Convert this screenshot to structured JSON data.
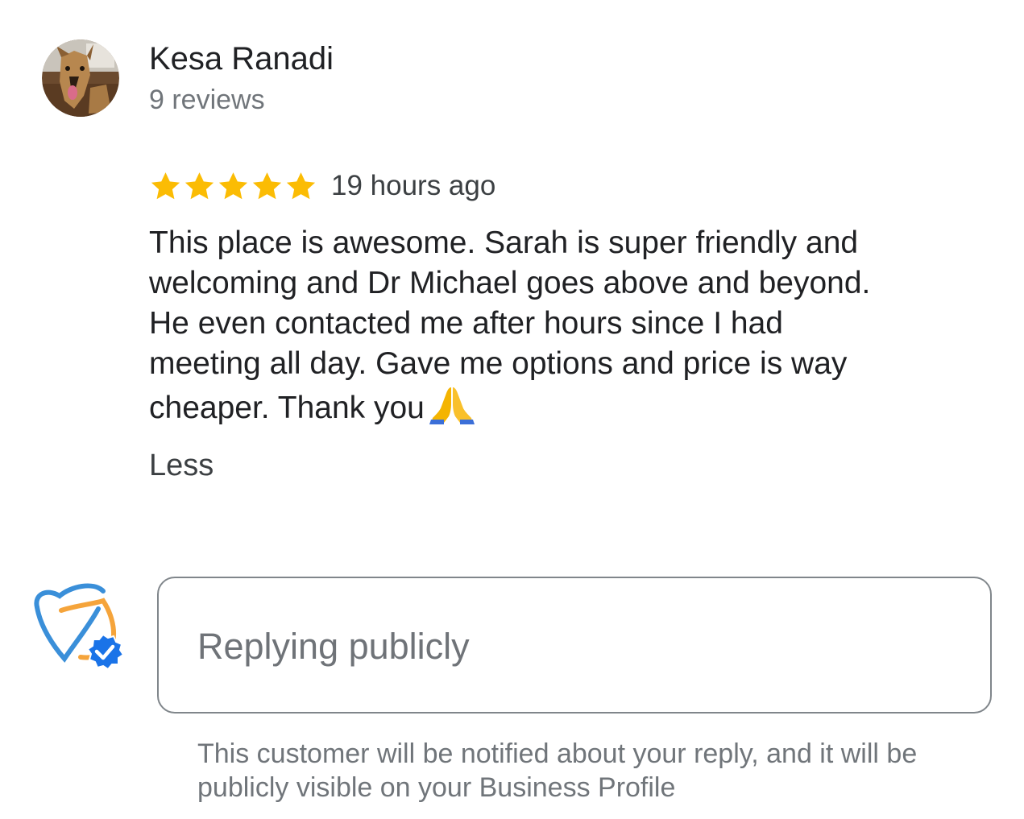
{
  "reviewer": {
    "avatar_icon": "dog-photo-avatar",
    "name": "Kesa Ranadi",
    "review_count": "9 reviews"
  },
  "review": {
    "rating": 5,
    "max_rating": 5,
    "star_color": "#fbbc04",
    "time_ago": "19 hours ago",
    "text_lines": [
      "This place is awesome. Sarah is super friendly and",
      "welcoming and Dr Michael goes above and beyond.",
      "He even contacted me after hours since I had",
      "meeting all day. Gave me options and price is way",
      "cheaper. Thank you"
    ],
    "emoji_icon": "folded-hands-icon",
    "less_label": "Less"
  },
  "reply": {
    "business_logo_icon": "tooth-logo-icon",
    "verified_icon": "verified-badge-icon",
    "placeholder": "Replying publicly",
    "value": "",
    "disclaimer": "This customer will be notified about your reply, and it will be publicly visible on your Business Profile"
  }
}
